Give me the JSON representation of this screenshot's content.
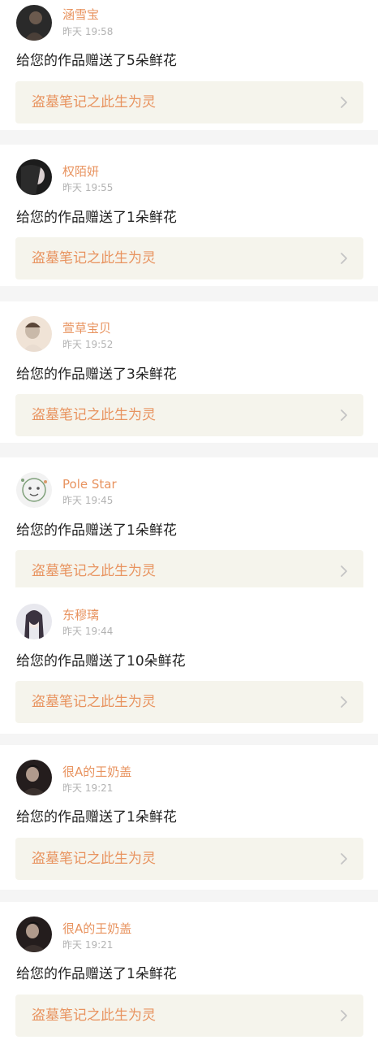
{
  "notifications": [
    {
      "user_name": "涵雪宝",
      "time": "昨天 19:58",
      "message": "给您的作品赠送了5朵鲜花",
      "work_title": "盗墓笔记之此生为灵",
      "avatar_colors": [
        "#2a2a2a",
        "#6b5a4e"
      ]
    },
    {
      "user_name": "权陌妍",
      "time": "昨天 19:55",
      "message": "给您的作品赠送了1朵鲜花",
      "work_title": "盗墓笔记之此生为灵",
      "avatar_colors": [
        "#1c1c1c",
        "#d9cfcf"
      ]
    },
    {
      "user_name": "萱草宝贝",
      "time": "昨天 19:52",
      "message": "给您的作品赠送了3朵鲜花",
      "work_title": "盗墓笔记之此生为灵",
      "avatar_colors": [
        "#c9b9a9",
        "#f0e3d6"
      ]
    },
    {
      "user_name": "Pole Star",
      "time": "昨天 19:45",
      "message": "给您的作品赠送了1朵鲜花",
      "work_title": "盗墓笔记之此生为灵",
      "avatar_colors": [
        "#f2f2f2",
        "#7fa07a"
      ]
    },
    {
      "user_name": "东穆璃",
      "time": "昨天 19:44",
      "message": "给您的作品赠送了10朵鲜花",
      "work_title": "盗墓笔记之此生为灵",
      "avatar_colors": [
        "#e8e8ee",
        "#3b3340"
      ]
    },
    {
      "user_name": "很A的王奶盖",
      "time": "昨天 19:21",
      "message": "给您的作品赠送了1朵鲜花",
      "work_title": "盗墓笔记之此生为灵",
      "avatar_colors": [
        "#241d1d",
        "#b09a8c"
      ]
    },
    {
      "user_name": "很A的王奶盖",
      "time": "昨天 19:21",
      "message": "给您的作品赠送了1朵鲜花",
      "work_title": "盗墓笔记之此生为灵",
      "avatar_colors": [
        "#241d1d",
        "#b09a8c"
      ]
    }
  ],
  "colors": {
    "accent": "#e8935f",
    "timestamp": "#b3b3b3",
    "link_background": "#f5f4ec",
    "page_background": "#f5f5f5"
  }
}
